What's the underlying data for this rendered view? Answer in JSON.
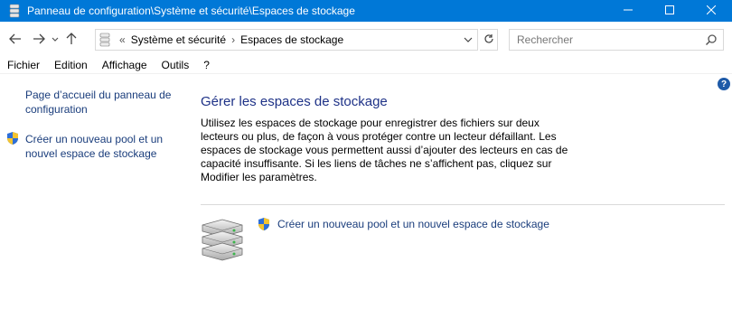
{
  "window": {
    "title": "Panneau de configuration\\Système et sécurité\\Espaces de stockage",
    "minimize_icon": "minimize-icon",
    "maximize_icon": "maximize-icon",
    "close_icon": "close-icon",
    "accent_color": "#0078d7"
  },
  "nav": {
    "back_icon": "arrow-left-icon",
    "forward_icon": "arrow-right-icon",
    "recent_icon": "chevron-down-icon",
    "up_icon": "arrow-up-icon",
    "address": {
      "overflow": "«",
      "crumbs": [
        "Système et sécurité",
        "Espaces de stockage"
      ],
      "separator": "›"
    },
    "refresh_icon": "refresh-icon",
    "search": {
      "placeholder": "Rechercher",
      "value": ""
    }
  },
  "menu": {
    "items": [
      "Fichier",
      "Edition",
      "Affichage",
      "Outils",
      "?"
    ]
  },
  "help": {
    "label": "?"
  },
  "left": {
    "home_link": "Page d’accueil du panneau de configuration",
    "create_link": "Créer un nouveau pool et un nouvel espace de stockage"
  },
  "main": {
    "title": "Gérer les espaces de stockage",
    "description": "Utilisez les espaces de stockage pour enregistrer des fichiers sur deux lecteurs ou plus, de façon à vous protéger contre un lecteur défaillant. Les espaces de stockage vous permettent aussi d’ajouter des lecteurs en cas de capacité insuffisante. Si les liens de tâches ne s’affichent pas, cliquez sur Modifier les paramètres.",
    "create_link": "Créer un nouveau pool et un nouvel espace de stockage",
    "link_color": "#1a3d7c",
    "title_color": "#1e3287"
  }
}
